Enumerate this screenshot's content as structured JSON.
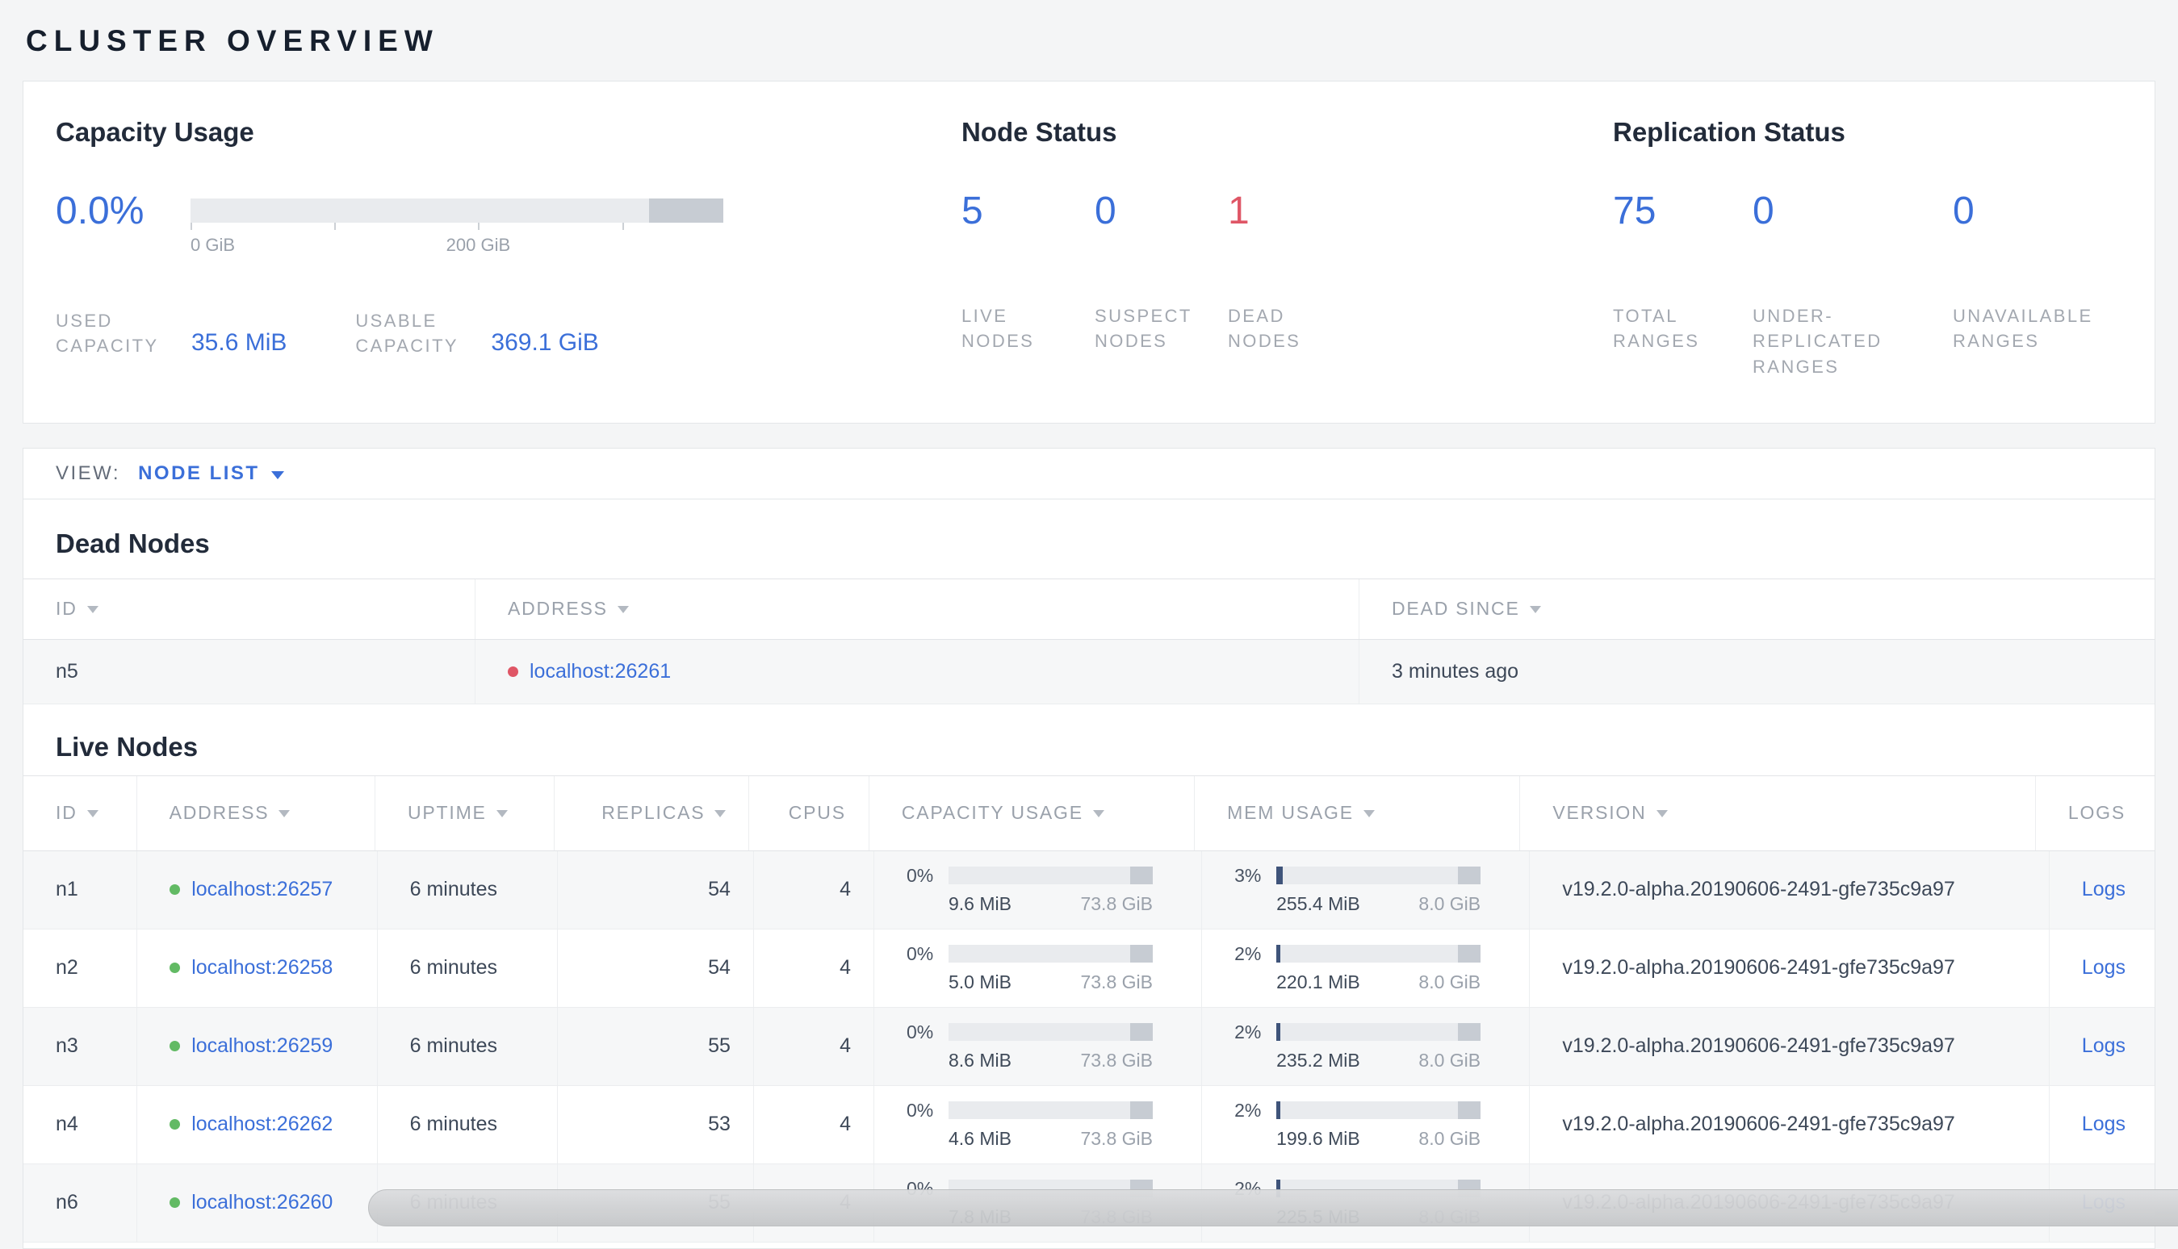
{
  "page_title": "CLUSTER OVERVIEW",
  "summary": {
    "capacity": {
      "title": "Capacity Usage",
      "percent": "0.0%",
      "bar_used_pct": 0,
      "axis_labels": [
        "0 GiB",
        "200 GiB"
      ],
      "stats": [
        {
          "label": "USED CAPACITY",
          "value": "35.6 MiB"
        },
        {
          "label": "USABLE CAPACITY",
          "value": "369.1 GiB"
        }
      ]
    },
    "node_status": {
      "title": "Node Status",
      "stats": [
        {
          "value": "5",
          "label": "LIVE NODES"
        },
        {
          "value": "0",
          "label": "SUSPECT NODES"
        },
        {
          "value": "1",
          "label": "DEAD NODES"
        }
      ]
    },
    "replication": {
      "title": "Replication Status",
      "stats": [
        {
          "value": "75",
          "label": "TOTAL RANGES"
        },
        {
          "value": "0",
          "label": "UNDER-REPLICATED RANGES"
        },
        {
          "value": "0",
          "label": "UNAVAILABLE RANGES"
        }
      ]
    }
  },
  "view_bar": {
    "label": "VIEW:",
    "selected": "NODE LIST"
  },
  "dead_nodes": {
    "title": "Dead Nodes",
    "columns": [
      "ID",
      "ADDRESS",
      "DEAD SINCE"
    ],
    "rows": [
      {
        "id": "n5",
        "address": "localhost:26261",
        "dead_since": "3 minutes ago"
      }
    ]
  },
  "live_nodes": {
    "title": "Live Nodes",
    "columns": [
      "ID",
      "ADDRESS",
      "UPTIME",
      "REPLICAS",
      "CPUS",
      "CAPACITY USAGE",
      "MEM USAGE",
      "VERSION",
      "LOGS"
    ],
    "rows": [
      {
        "id": "n1",
        "address": "localhost:26257",
        "uptime": "6 minutes",
        "replicas": "54",
        "cpus": "4",
        "capacity": {
          "percent": "0%",
          "used_pct": 0,
          "used": "9.6 MiB",
          "total": "73.8 GiB"
        },
        "mem": {
          "percent": "3%",
          "used_pct": 3,
          "used": "255.4 MiB",
          "total": "8.0 GiB"
        },
        "version": "v19.2.0-alpha.20190606-2491-gfe735c9a97",
        "logs_label": "Logs"
      },
      {
        "id": "n2",
        "address": "localhost:26258",
        "uptime": "6 minutes",
        "replicas": "54",
        "cpus": "4",
        "capacity": {
          "percent": "0%",
          "used_pct": 0,
          "used": "5.0 MiB",
          "total": "73.8 GiB"
        },
        "mem": {
          "percent": "2%",
          "used_pct": 2,
          "used": "220.1 MiB",
          "total": "8.0 GiB"
        },
        "version": "v19.2.0-alpha.20190606-2491-gfe735c9a97",
        "logs_label": "Logs"
      },
      {
        "id": "n3",
        "address": "localhost:26259",
        "uptime": "6 minutes",
        "replicas": "55",
        "cpus": "4",
        "capacity": {
          "percent": "0%",
          "used_pct": 0,
          "used": "8.6 MiB",
          "total": "73.8 GiB"
        },
        "mem": {
          "percent": "2%",
          "used_pct": 2,
          "used": "235.2 MiB",
          "total": "8.0 GiB"
        },
        "version": "v19.2.0-alpha.20190606-2491-gfe735c9a97",
        "logs_label": "Logs"
      },
      {
        "id": "n4",
        "address": "localhost:26262",
        "uptime": "6 minutes",
        "replicas": "53",
        "cpus": "4",
        "capacity": {
          "percent": "0%",
          "used_pct": 0,
          "used": "4.6 MiB",
          "total": "73.8 GiB"
        },
        "mem": {
          "percent": "2%",
          "used_pct": 2,
          "used": "199.6 MiB",
          "total": "8.0 GiB"
        },
        "version": "v19.2.0-alpha.20190606-2491-gfe735c9a97",
        "logs_label": "Logs"
      },
      {
        "id": "n6",
        "address": "localhost:26260",
        "uptime": "6 minutes",
        "replicas": "55",
        "cpus": "4",
        "capacity": {
          "percent": "0%",
          "used_pct": 0,
          "used": "7.8 MiB",
          "total": "73.8 GiB"
        },
        "mem": {
          "percent": "2%",
          "used_pct": 2,
          "used": "225.5 MiB",
          "total": "8.0 GiB"
        },
        "version": "v19.2.0-alpha.20190606-2491-gfe735c9a97",
        "logs_label": "Logs"
      }
    ]
  }
}
